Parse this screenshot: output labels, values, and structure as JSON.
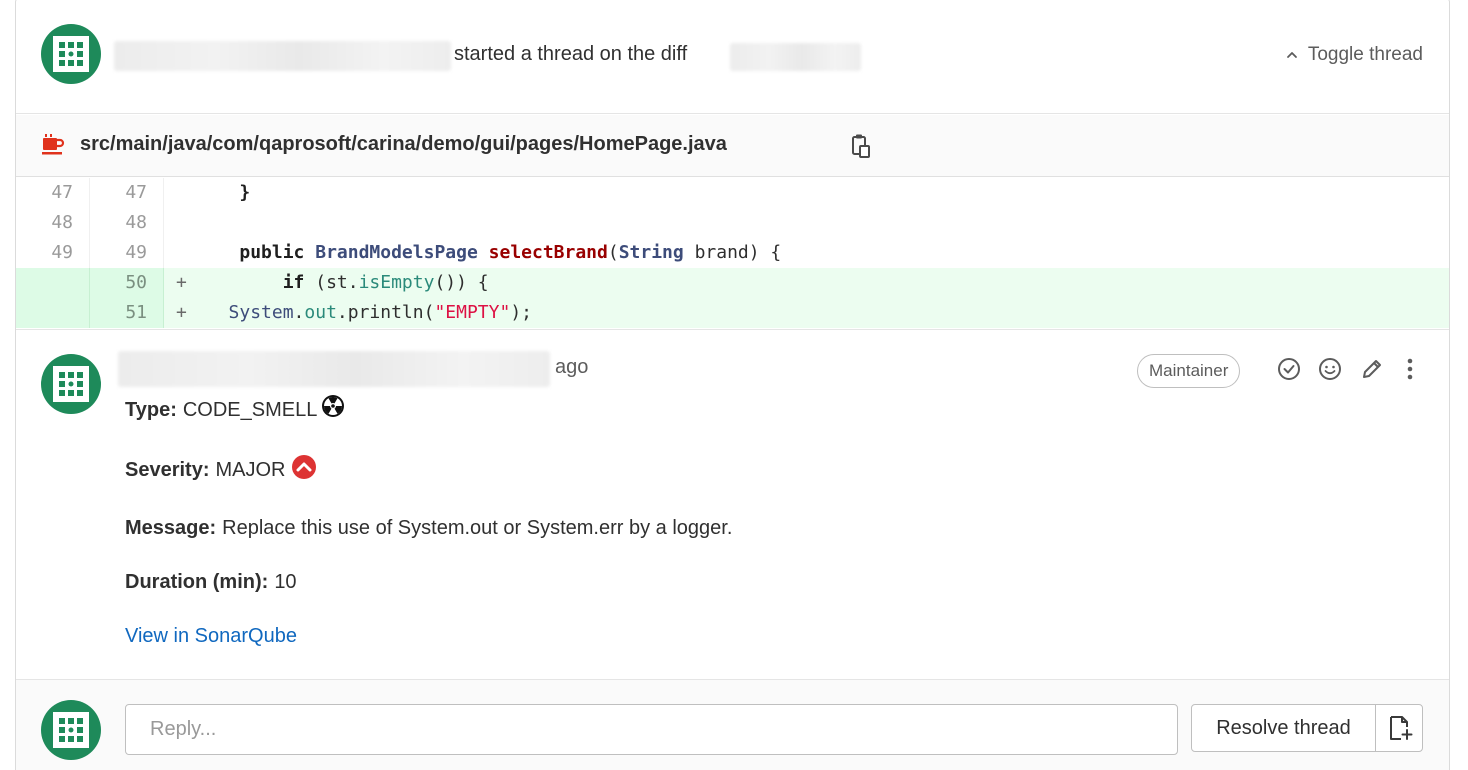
{
  "header": {
    "action_text": "started a thread on the diff",
    "toggle_label": "Toggle thread"
  },
  "file": {
    "path": "src/main/java/com/qaprosoft/carina/demo/gui/pages/HomePage.java"
  },
  "diff": {
    "lines": [
      {
        "old": "47",
        "new": "47",
        "sign": "",
        "type": "context"
      },
      {
        "old": "48",
        "new": "48",
        "sign": "",
        "type": "context"
      },
      {
        "old": "49",
        "new": "49",
        "sign": "",
        "type": "context"
      },
      {
        "old": "",
        "new": "50",
        "sign": "+",
        "type": "added"
      },
      {
        "old": "",
        "new": "51",
        "sign": "+",
        "type": "added"
      }
    ],
    "code": {
      "l47": "}",
      "l49_kw": "public",
      "l49_type": "BrandModelsPage",
      "l49_fn": "selectBrand",
      "l49_open": "(",
      "l49_ptype": "String",
      "l49_rest": " brand) {",
      "l50_kw": "if",
      "l50_a": " (st.",
      "l50_method": "isEmpty",
      "l50_b": "()) {",
      "l51_cls": "System",
      "l51_dot": ".",
      "l51_field": "out",
      "l51_call": ".println(",
      "l51_str": "\"EMPTY\"",
      "l51_end": ");"
    }
  },
  "note": {
    "ago": "ago",
    "role_badge": "Maintainer",
    "type_label": "Type:",
    "type_value": "CODE_SMELL",
    "severity_label": "Severity:",
    "severity_value": "MAJOR",
    "message_label": "Message:",
    "message_value": "Replace this use of System.out or System.err by a logger.",
    "duration_label": "Duration (min):",
    "duration_value": "10",
    "link_label": "View in SonarQube"
  },
  "reply": {
    "placeholder": "Reply...",
    "resolve_label": "Resolve thread"
  },
  "colors": {
    "avatar": "#1e8a5a",
    "link": "#1068bf",
    "added_bg": "#ecfdf0",
    "severity": "#dd3333",
    "file_icon": "#e0321c"
  },
  "icons": [
    "chevron-up-icon",
    "java-file-icon",
    "clipboard-icon",
    "radiation-icon",
    "severity-major-icon",
    "resolve-check-icon",
    "smiley-icon",
    "pencil-icon",
    "kebab-menu-icon",
    "resolve-new-issue-icon"
  ]
}
